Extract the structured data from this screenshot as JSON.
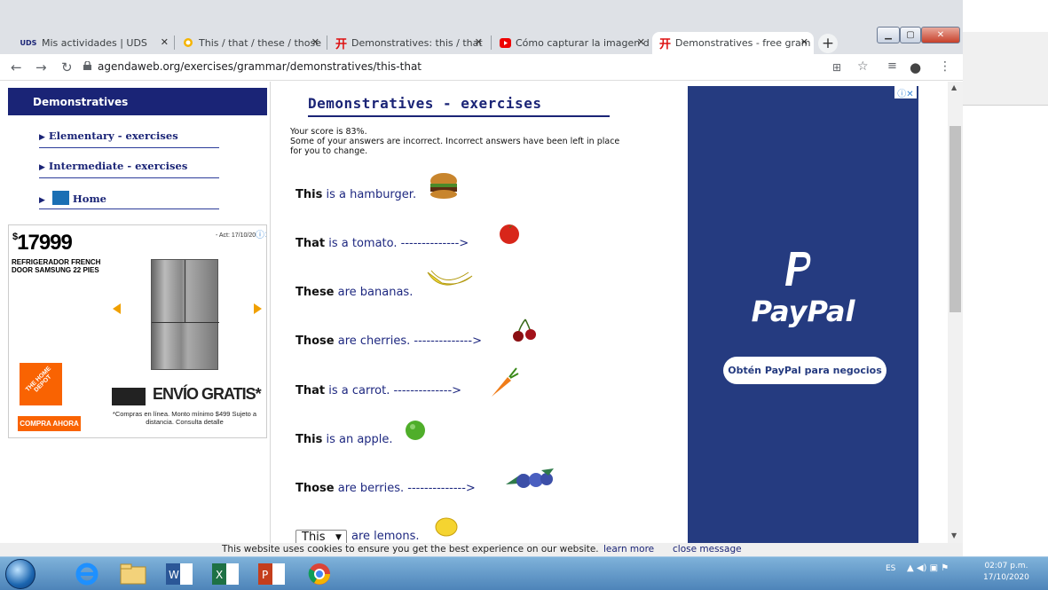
{
  "browser": {
    "tabs": [
      {
        "label": "Mis actividades | UDS",
        "favicon": "UDS"
      },
      {
        "label": "This / that / these / those |",
        "favicon": "search"
      },
      {
        "label": "Demonstratives: this / that",
        "favicon": "agendaweb"
      },
      {
        "label": "Cómo capturar la imagen d",
        "favicon": "youtube"
      },
      {
        "label": "Demonstratives - free gram",
        "favicon": "agendaweb"
      }
    ],
    "new_tab": "+",
    "url": "agendaweb.org/exercises/grammar/demonstratives/this-that"
  },
  "sidebar": {
    "title": "Demonstratives",
    "links": [
      {
        "label": "Elementary - exercises"
      },
      {
        "label": "Intermediate - exercises"
      },
      {
        "label": "Home"
      }
    ]
  },
  "ad_left": {
    "price_symbol": "$",
    "price": "17999",
    "act_date": "- Act: 17/10/20",
    "product": "REFRIGERADOR FRENCH DOOR SAMSUNG 22 PIES",
    "cta": "COMPRA AHORA",
    "shipping": "ENVÍO GRATIS*",
    "fine_print": "*Compras en línea. Monto mínimo $499 Sujeto a distancia. Consulta detalle",
    "brand_color": "#f96302"
  },
  "exercise": {
    "title": "Demonstratives - exercises",
    "score_line": "Your score is 83%.",
    "score_note": "Some of your answers are incorrect. Incorrect answers have been left in place for you to change.",
    "sentences": [
      {
        "word": "This",
        "rest": " is a hamburger.",
        "picture": "hamburger"
      },
      {
        "word": "That",
        "rest": " is a tomato. -------------->",
        "picture": "tomato"
      },
      {
        "word": "These",
        "rest": " are bananas.",
        "picture": "bananas"
      },
      {
        "word": "Those",
        "rest": " are cherries. -------------->",
        "picture": "cherries"
      },
      {
        "word": "That",
        "rest": " is a carrot. -------------->",
        "picture": "carrot"
      },
      {
        "word": "This",
        "rest": " is an apple.",
        "picture": "apple"
      },
      {
        "word": "Those",
        "rest": " are berries. -------------->",
        "picture": "berries"
      }
    ],
    "lemon": {
      "selected": "This",
      "rest": " are lemons.",
      "picture": "lemon"
    }
  },
  "ad_right": {
    "brand": "PayPal",
    "button": "Obtén PayPal para negocios",
    "bg_color": "#253b80"
  },
  "cookie": {
    "message": "This website uses cookies to ensure you get the best experience on our website.",
    "learn_more": "learn more",
    "close": "close message"
  },
  "taskbar": {
    "lang": "ES",
    "time": "02:07 p.m.",
    "date": "17/10/2020"
  }
}
